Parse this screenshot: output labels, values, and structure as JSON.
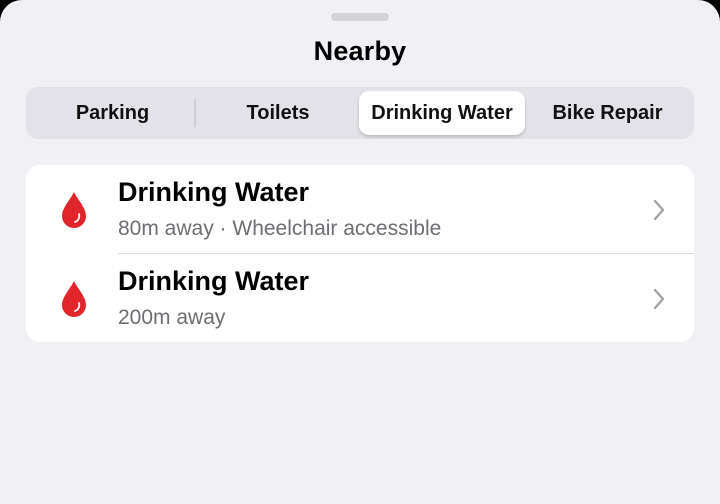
{
  "sheet": {
    "title": "Nearby"
  },
  "tabs": [
    {
      "label": "Parking",
      "selected": false
    },
    {
      "label": "Toilets",
      "selected": false
    },
    {
      "label": "Drinking Water",
      "selected": true
    },
    {
      "label": "Bike Repair",
      "selected": false
    }
  ],
  "results": [
    {
      "icon": "water-drop-icon",
      "title": "Drinking Water",
      "subtitle": "80m away · Wheelchair accessible"
    },
    {
      "icon": "water-drop-icon",
      "title": "Drinking Water",
      "subtitle": "200m away"
    }
  ],
  "colors": {
    "background": "#f1f0f5",
    "card": "#ffffff",
    "drop": "#e0252b",
    "secondary_text": "#6e6d72"
  }
}
